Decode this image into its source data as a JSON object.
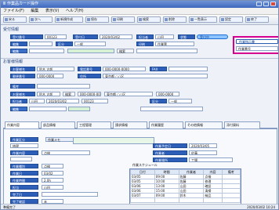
{
  "titlebar": {
    "title": "Ⅲ 作業品カード操作"
  },
  "menu": [
    "ファイル(F)",
    "編集",
    "表示(V)",
    "ヘルプ(H)"
  ],
  "toolbar": [
    "戻る",
    "次へ",
    "新規作成",
    "保存",
    "印刷",
    "検索",
    "削除",
    "一覧表示",
    "設定",
    "終了"
  ],
  "sections": {
    "header": "受付情報",
    "customer": "お客様情報"
  },
  "header": {
    "receipt_no_label": "受付番号",
    "receipt_no": "00123",
    "receipt_date_label": "受付日",
    "receipt_date": "2020/03/02",
    "staff_label": "担当者",
    "staff": "山田",
    "status_label": "状態",
    "status": "受付中",
    "edit_label": "編集",
    "edit_value": "",
    "group_label": "区分",
    "group": "一般",
    "print_label": "印刷",
    "print_value": "作業票"
  },
  "highlight": {
    "title": "作業指示書",
    "line": "作業番号",
    "value": ""
  },
  "customer": {
    "name_label": "お客様名",
    "name": "鈴木 太郎",
    "phone_label": "電話番号",
    "phone": "000-0000-0000",
    "address_label": "住所",
    "address": "東京都 ○○区",
    "zip_label": "郵便番号",
    "zip": "000-0000",
    "fax_label": "FAX",
    "fax": "",
    "memo_label": "備考",
    "memo": ""
  },
  "tabs": [
    "作業内容",
    "部品情報",
    "工程管理",
    "請求情報",
    "作業履歴",
    "その他情報",
    "添付資料"
  ],
  "panel": {
    "left_labels": [
      "作業区分",
      "作業内容",
      "作業種別",
      "作業日",
      "作業時間",
      "担当",
      "完了日",
      "完了確認",
      "備考"
    ],
    "left_values": [
      "修理",
      "",
      "点検",
      "03/02",
      "2.0h",
      "山田",
      "",
      "未",
      ""
    ],
    "middle_label": "作業メモ",
    "middle_value": "",
    "right_labels": [
      "作業予定日",
      "作業者",
      "作業場所"
    ],
    "right_values": [
      "2020/03/05",
      "佐藤",
      "工場"
    ],
    "table_title": "作業スケジュール",
    "table_headers": [
      "日付",
      "時間",
      "作業者",
      "内容",
      "備考"
    ],
    "table_rows": [
      [
        "03/05",
        "09:00",
        "佐藤",
        "点検",
        ""
      ],
      [
        "03/05",
        "10:00",
        "佐藤",
        "修理",
        ""
      ],
      [
        "03/06",
        "13:00",
        "山田",
        "確認",
        ""
      ],
      [
        "03/06",
        "15:00",
        "山田",
        "清掃",
        ""
      ],
      [
        "03/07",
        "09:00",
        "鈴木",
        "納品",
        ""
      ],
      [
        "",
        "",
        "",
        "",
        ""
      ]
    ]
  },
  "status": {
    "left": "準備完了",
    "right": "2020/03/02 10:24"
  }
}
